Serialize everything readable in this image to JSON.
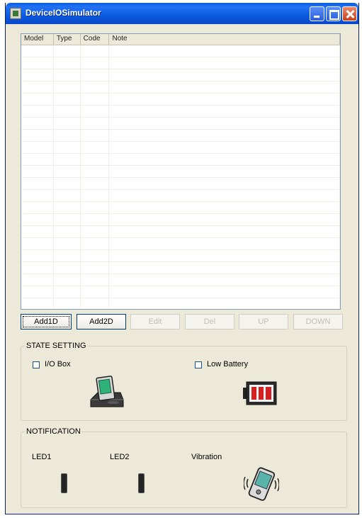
{
  "window": {
    "title": "DeviceIOSimulator"
  },
  "table": {
    "columns": [
      "Model",
      "Type",
      "Code",
      "Note"
    ],
    "rows": []
  },
  "buttons": {
    "add1d": "Add1D",
    "add2d": "Add2D",
    "edit": "Edit",
    "del": "Del",
    "up": "UP",
    "down": "DOWN"
  },
  "state_setting": {
    "legend": "STATE SETTING",
    "io_box": {
      "label": "I/O Box",
      "checked": false
    },
    "low_battery": {
      "label": "Low Battery",
      "checked": false
    }
  },
  "notification": {
    "legend": "NOTIFICATION",
    "led1": "LED1",
    "led2": "LED2",
    "vibration": "Vibration"
  },
  "icons": {
    "app": "app-icon",
    "cradle": "cradle-icon",
    "battery": "battery-icon",
    "vibration": "vibrating-device-icon"
  },
  "colors": {
    "titlebar": "#0a5ee0",
    "face": "#ece9d8",
    "list_border": "#7f9db9",
    "battery_red": "#d42020",
    "led_off": "#242424"
  }
}
